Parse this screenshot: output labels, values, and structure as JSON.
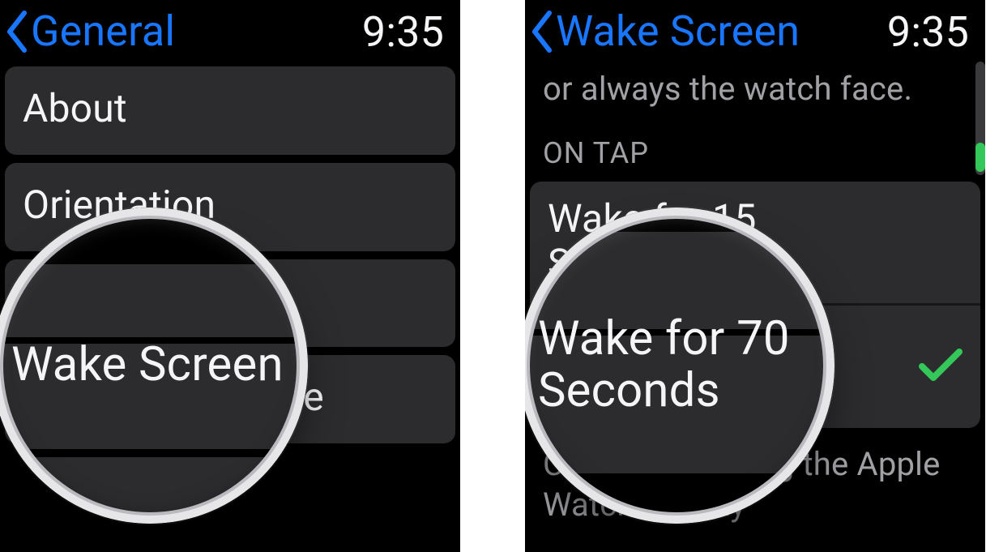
{
  "left": {
    "back_label": "General",
    "time": "9:35",
    "items": [
      {
        "label": "About"
      },
      {
        "label": "Orientation"
      },
      {
        "label": "Wake Screen"
      },
      {
        "label": "Nightstand Mode"
      }
    ],
    "magnified": "Wake Screen"
  },
  "right": {
    "back_label": "Wake Screen",
    "time": "9:35",
    "desc_visible": "or always the watch face.",
    "section": "ON TAP",
    "options": [
      {
        "label": "Wake for 15 Seconds",
        "selected": false
      },
      {
        "label": "Wake for 70 Seconds",
        "selected": true
      }
    ],
    "footer_visible": "Choose how long the Apple Watch display",
    "magnified_line1": "Wake for 70",
    "magnified_line2": "Seconds"
  },
  "colors": {
    "link": "#1976ff",
    "accent": "#34c759",
    "cell": "#2c2c2e"
  }
}
